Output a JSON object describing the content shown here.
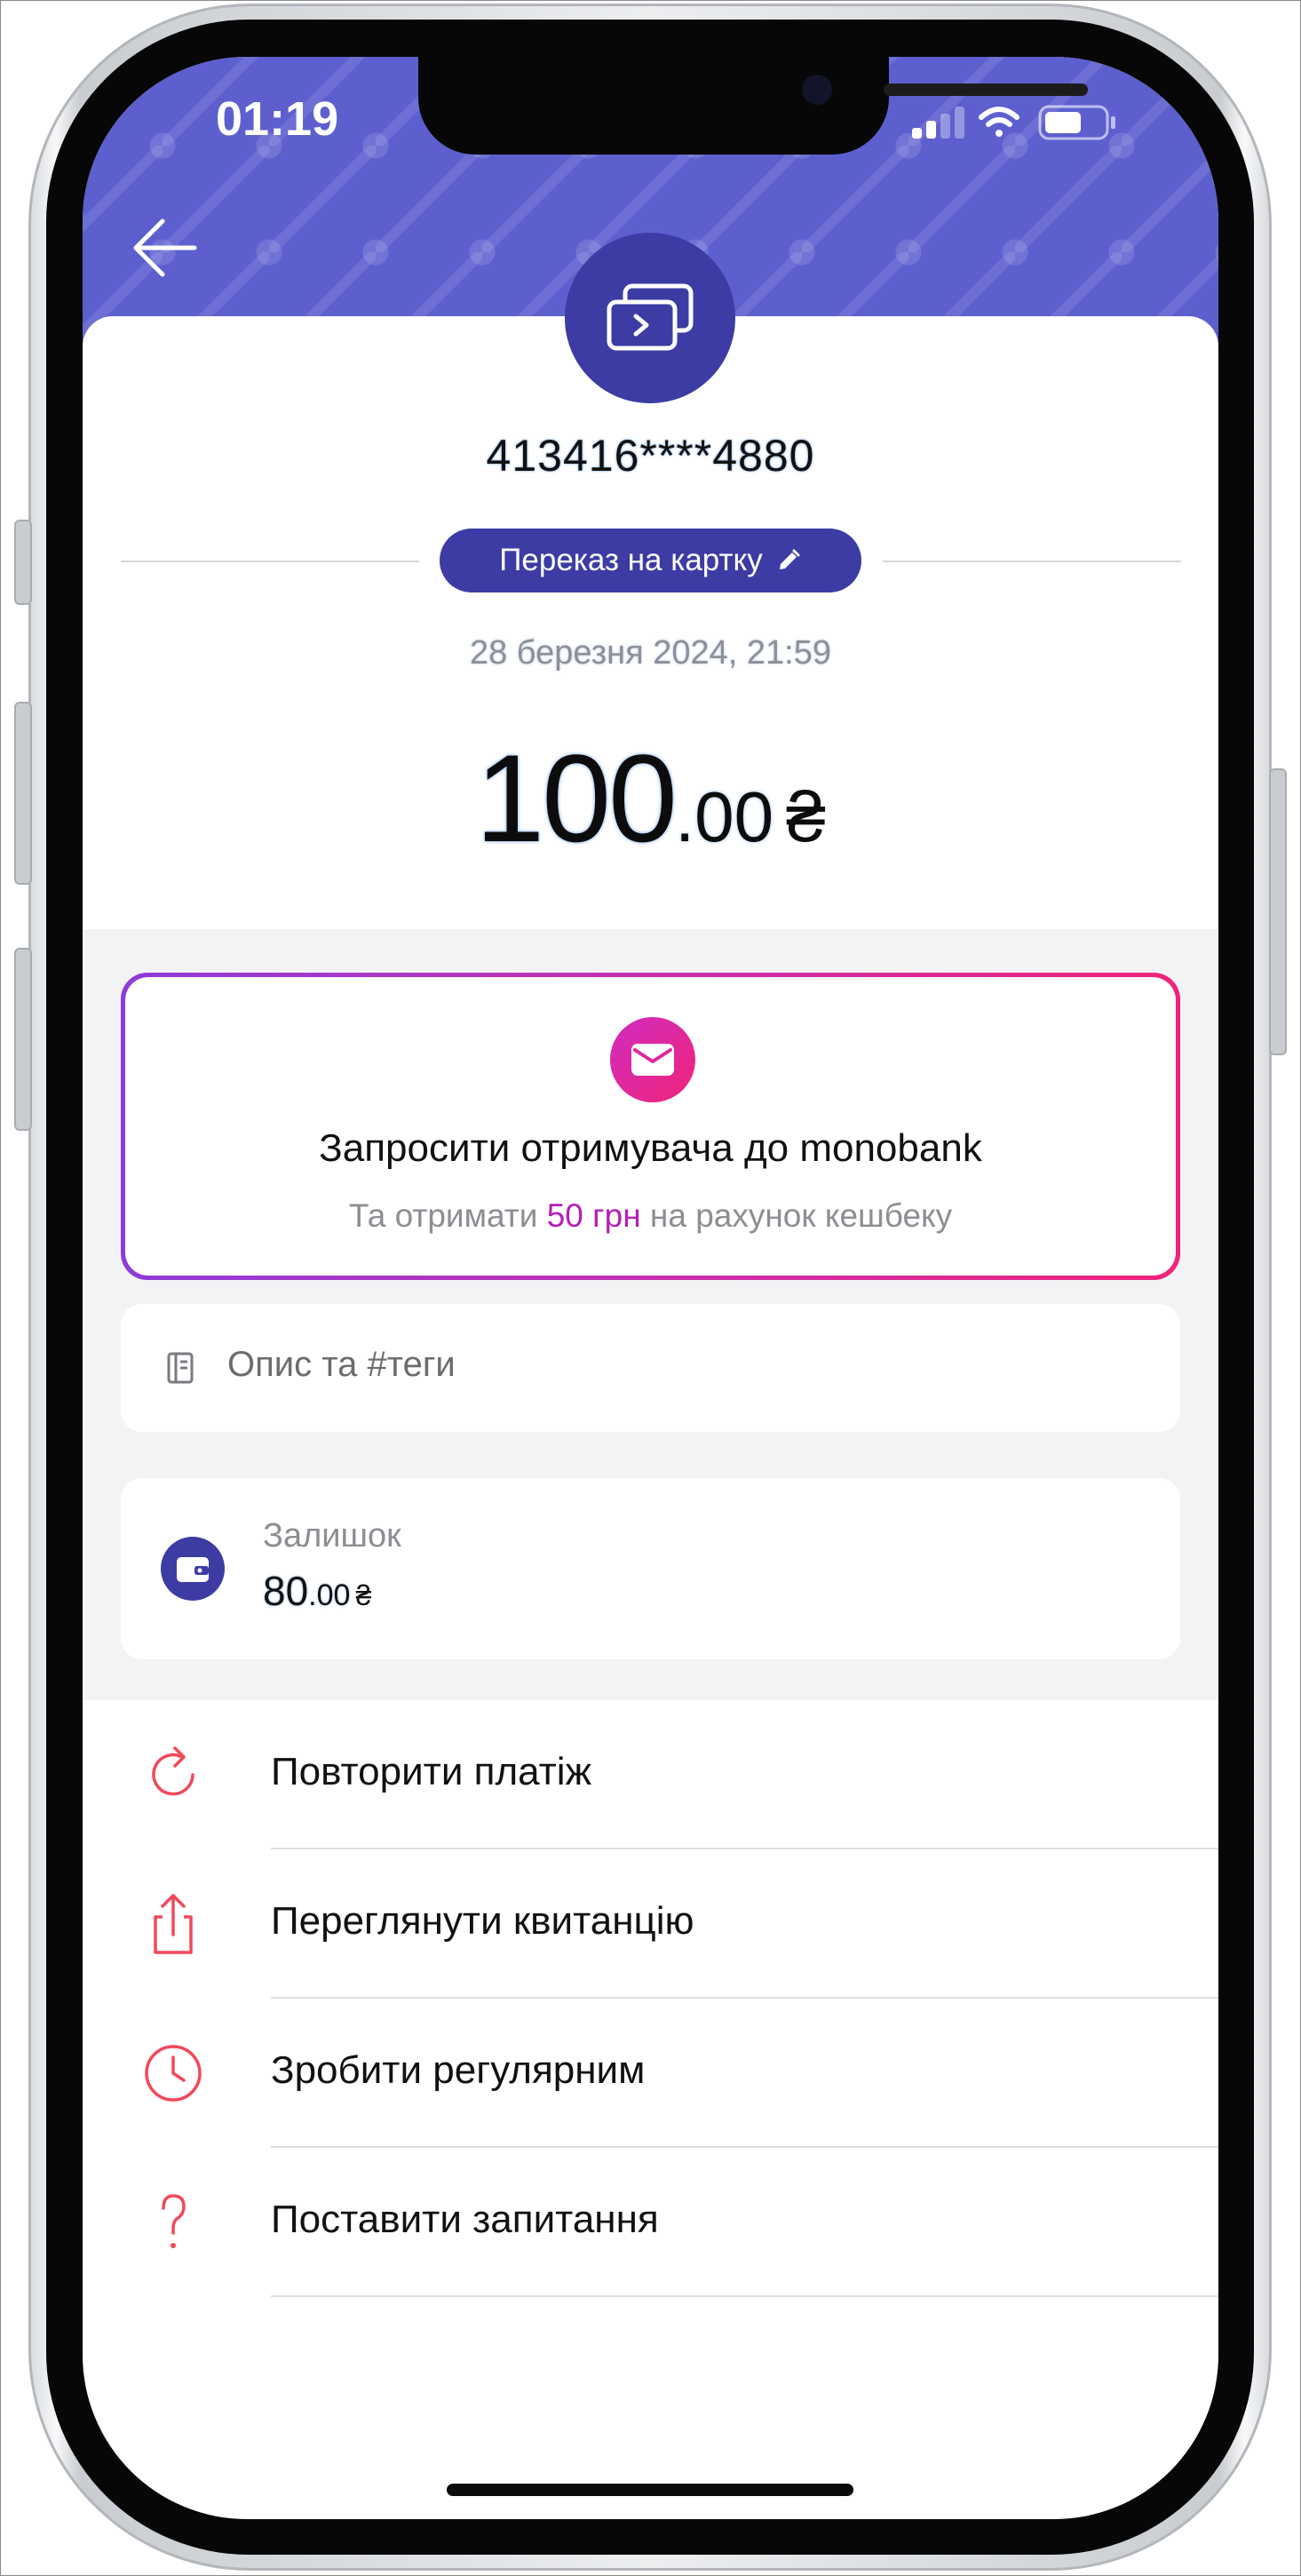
{
  "status_bar": {
    "time": "01:19"
  },
  "transaction": {
    "card_number": "413416****4880",
    "category": "Переказ на картку",
    "datetime": "28 березня 2024, 21:59",
    "amount_integer": "100",
    "amount_decimal": ".00",
    "currency_symbol": "₴"
  },
  "invite_banner": {
    "title": "Запросити отримувача до monobank",
    "subtitle_before": "Та отримати ",
    "subtitle_highlight": "50 грн",
    "subtitle_after": " на рахунок кешбеку"
  },
  "note": {
    "placeholder": "Опис та #теги"
  },
  "balance": {
    "label": "Залишок",
    "integer": "80",
    "decimal": ".00",
    "currency_symbol": "₴"
  },
  "actions": [
    {
      "label": "Повторити платіж",
      "icon": "repeat-icon"
    },
    {
      "label": "Переглянути квитанцію",
      "icon": "share-icon"
    },
    {
      "label": "Зробити регулярним",
      "icon": "clock-icon"
    },
    {
      "label": "Поставити запитання",
      "icon": "question-icon"
    }
  ],
  "colors": {
    "header": "#5d5fcf",
    "accent": "#3c3ca4",
    "action_icons": "#f2485a",
    "gradient_start": "#8e3bd9",
    "gradient_end": "#f0247a",
    "highlight": "#b51fb5"
  }
}
